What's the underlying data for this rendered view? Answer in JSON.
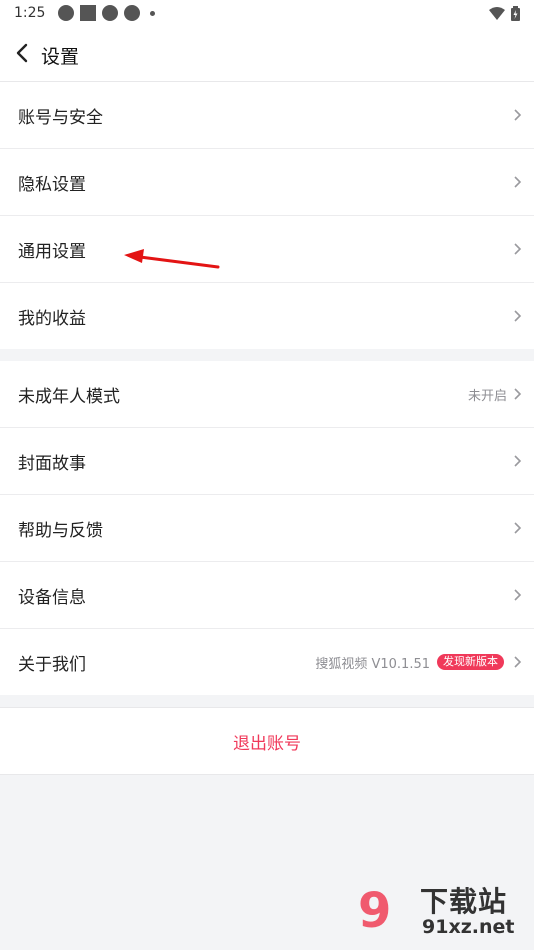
{
  "status_bar": {
    "time": "1:25"
  },
  "header": {
    "title": "设置"
  },
  "group1": [
    {
      "label": "账号与安全"
    },
    {
      "label": "隐私设置"
    },
    {
      "label": "通用设置"
    },
    {
      "label": "我的收益"
    }
  ],
  "group2": {
    "minor_mode": {
      "label": "未成年人模式",
      "status": "未开启"
    },
    "cover_story": {
      "label": "封面故事"
    },
    "help": {
      "label": "帮助与反馈"
    },
    "device": {
      "label": "设备信息"
    },
    "about": {
      "label": "关于我们",
      "version": "搜狐视频 V10.1.51",
      "badge": "发现新版本"
    }
  },
  "logout": {
    "label": "退出账号"
  },
  "watermark": {
    "logo": "9",
    "title": "下载站",
    "url": "91xz.net"
  },
  "colors": {
    "accent": "#f0395a",
    "annotation_arrow": "#e31414"
  }
}
